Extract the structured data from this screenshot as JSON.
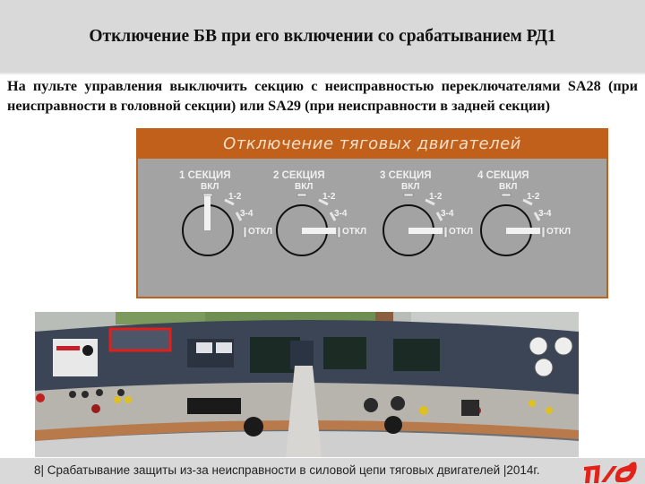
{
  "header": {
    "title": "Отключение БВ при его включении со срабатыванием РД1"
  },
  "body": {
    "instruction": "На пульте управления выключить секцию с неисправностью переключателями SA28 (при неисправности в головной секции) или SA29 (при неисправности в задней секции)"
  },
  "panel": {
    "title": "Отключение тяговых двигателей",
    "positions": {
      "on": "ВКЛ",
      "p12": "1-2",
      "p34": "3-4",
      "off": "ОТКЛ"
    },
    "sections": [
      {
        "label": "1 СЕКЦИЯ",
        "state": "ВКЛ"
      },
      {
        "label": "2 СЕКЦИЯ",
        "state": "ОТКЛ"
      },
      {
        "label": "3 СЕКЦИЯ",
        "state": "ОТКЛ"
      },
      {
        "label": "4 СЕКЦИЯ",
        "state": "ОТКЛ"
      }
    ],
    "colors": {
      "accent": "#c1601a",
      "background": "#a3a3a3"
    }
  },
  "photo": {
    "description": "Locomotive driver control desk with highlighted switch panel",
    "highlight_color": "#e0201b"
  },
  "footer": {
    "text": "8| Срабатывание защиты из-за неисправности в силовой цепи тяговых двигателей |2014г.",
    "logo": "РЖД",
    "logo_color": "#e2231a"
  }
}
